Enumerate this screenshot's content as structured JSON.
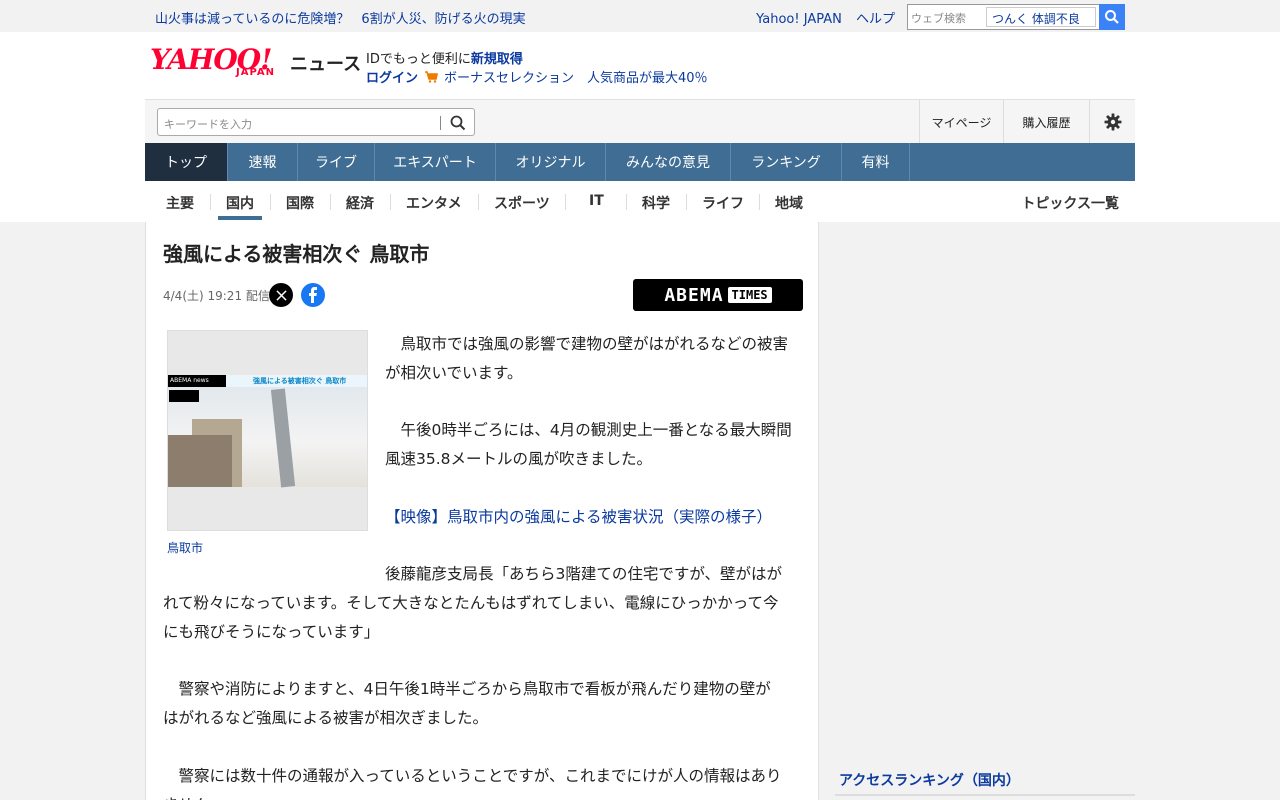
{
  "top_strip": {
    "promo_1": "山火事は減っているのに危険増？",
    "promo_2": "6割が人災、防げる火の現実",
    "link_yahoo": "Yahoo! JAPAN",
    "link_help": "ヘルプ",
    "web_search_placeholder": "ウェブ検索",
    "web_search_hint": "つんく 体調不良"
  },
  "header": {
    "logo_text": "YAHOO!",
    "logo_sub": "JAPAN",
    "news_label": "ニュース",
    "id_prefix": "IDでもっと便利に",
    "id_register": "新規取得",
    "login": "ログイン",
    "bonus": "ボーナスセレクション　人気商品が最大40％"
  },
  "search": {
    "placeholder": "キーワードを入力",
    "mypage": "マイページ",
    "history": "購入履歴"
  },
  "main_nav": [
    {
      "label": "トップ",
      "active": true
    },
    {
      "label": "速報"
    },
    {
      "label": "ライブ"
    },
    {
      "label": "エキスパート"
    },
    {
      "label": "オリジナル"
    },
    {
      "label": "みんなの意見"
    },
    {
      "label": "ランキング"
    },
    {
      "label": "有料"
    }
  ],
  "sub_nav": [
    {
      "label": "主要"
    },
    {
      "label": "国内",
      "active": true
    },
    {
      "label": "国際"
    },
    {
      "label": "経済"
    },
    {
      "label": "エンタメ"
    },
    {
      "label": "スポーツ"
    },
    {
      "label": "IT"
    },
    {
      "label": "科学"
    },
    {
      "label": "ライフ"
    },
    {
      "label": "地域"
    }
  ],
  "topics_all": "トピックス一覧",
  "article": {
    "title": "強風による被害相次ぐ 鳥取市",
    "date": "4/4(土) 19:21 配信",
    "source_logo": "ABEMA",
    "source_logo_tag": "TIMES",
    "photo_logo": "ABEMA news",
    "photo_caption_overlay": "強風による被害相次ぐ 鳥取市",
    "photo_caption": "鳥取市",
    "para1_l1": "　鳥取市では強風の影響で建物の壁がはがれるなどの被害",
    "para1_l2": "が相次いでいます。",
    "para2_l1": "　午後0時半ごろには、4月の観測史上一番となる最大瞬間",
    "para2_l2": "風速35.8メートルの風が吹きました。",
    "video_link": "【映像】鳥取市内の強風による被害状況（実際の様子）",
    "para3_l1": "後藤龍彦支局長「あちら3階建ての住宅ですが、壁がはが",
    "para3_l2": "れて粉々になっています。そして大きなとたんもはずれてしまい、電線にひっかかって今",
    "para3_l3": "にも飛びそうになっています」",
    "para4_l1": "　警察や消防によりますと、4日午後1時半ごろから鳥取市で看板が飛んだり建物の壁が",
    "para4_l2": "はがれるなど強風による被害が相次ぎました。",
    "para5_l1": "　警察には数十件の通報が入っているということですが、これまでにけが人の情報はあり",
    "para5_l2": "ません。"
  },
  "sidebar": {
    "ranking_title": "アクセスランキング（国内）"
  },
  "colors": {
    "nav_bg": "#3f6d93",
    "nav_active": "#1f2f3f",
    "link": "#0b3a9f",
    "brand_red": "#ff0033"
  }
}
